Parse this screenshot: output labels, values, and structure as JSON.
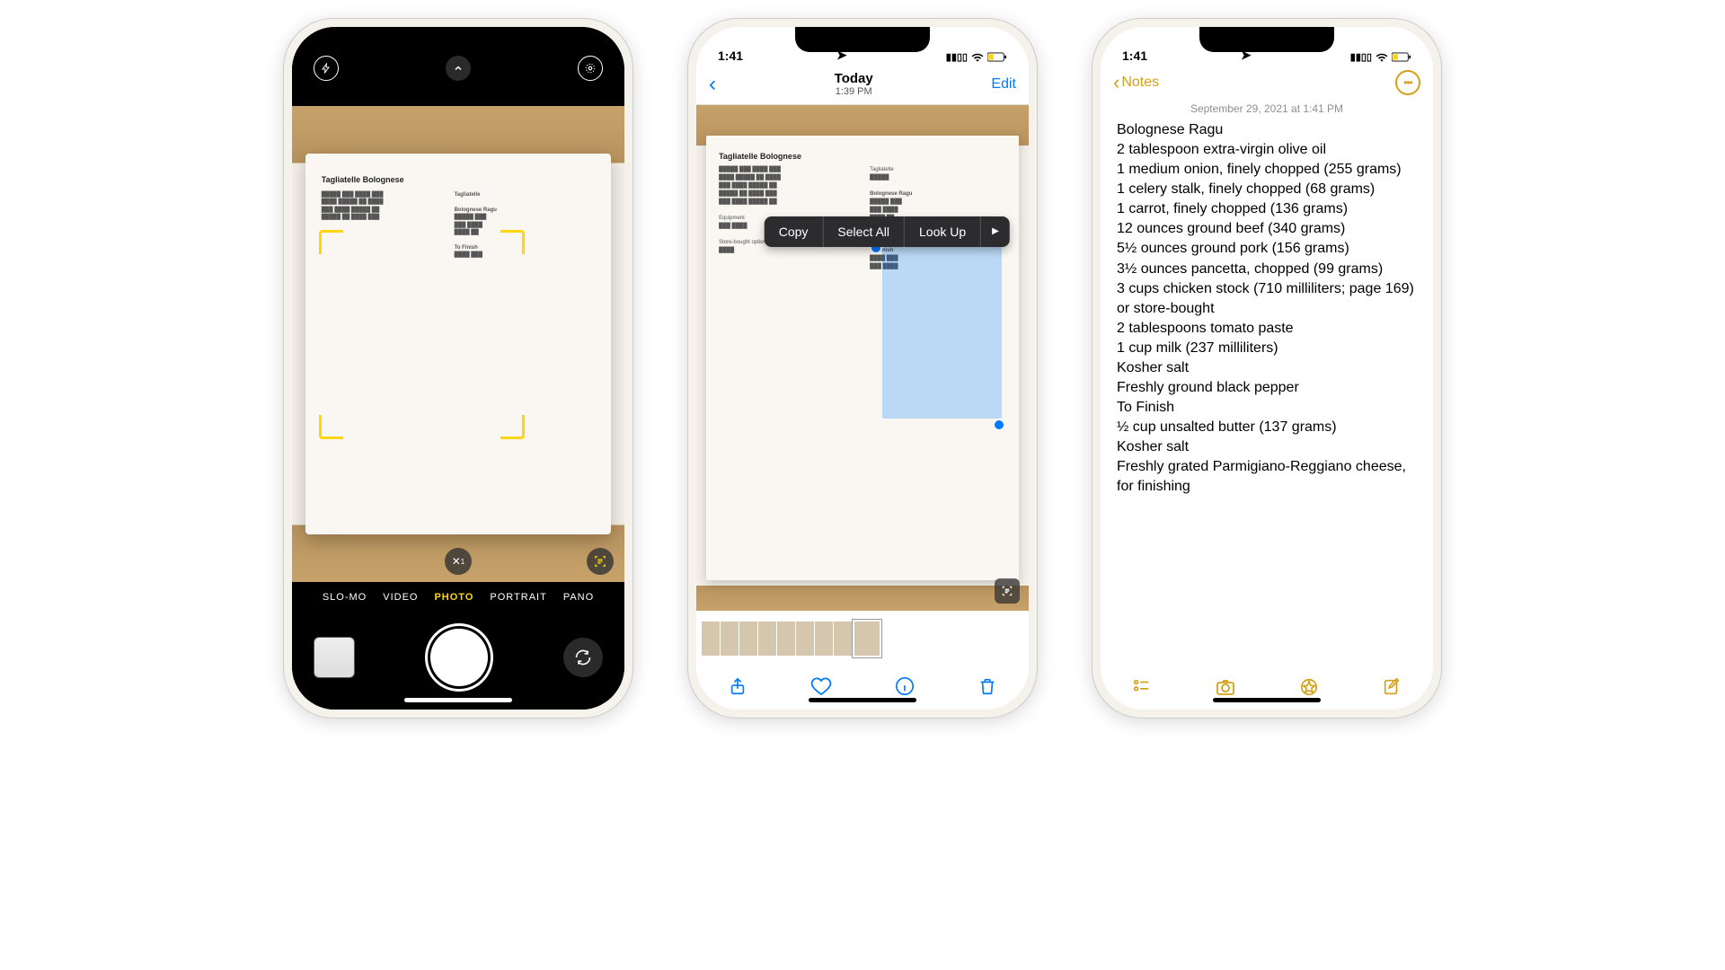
{
  "accent_ios_blue": "#007aff",
  "accent_notes_gold": "#d4a017",
  "accent_camera_yellow": "#ffd60a",
  "camera": {
    "modes": [
      "SLO-MO",
      "VIDEO",
      "PHOTO",
      "PORTRAIT",
      "PANO"
    ],
    "active_mode": "PHOTO",
    "page_title": "Tagliatelle Bolognese"
  },
  "photos": {
    "status_time": "1:41",
    "nav_title": "Today",
    "nav_subtitle": "1:39 PM",
    "edit_label": "Edit",
    "context_menu": [
      "Copy",
      "Select All",
      "Look Up"
    ],
    "page_title": "Tagliatelle Bolognese"
  },
  "notes": {
    "status_time": "1:41",
    "back_label": "Notes",
    "date_line": "September 29, 2021 at 1:41 PM",
    "lines": [
      "Bolognese Ragu",
      "2 tablespoon extra-virgin olive oil",
      "1 medium onion, finely chopped (255 grams)",
      "1 celery stalk, finely chopped (68 grams)",
      "1 carrot, finely chopped (136 grams)",
      "12 ounces ground beef (340 grams)",
      "5½ ounces ground pork (156 grams)",
      "3½ ounces pancetta, chopped (99 grams)",
      "3 cups chicken stock (710 milliliters; page 169) or store-bought",
      "2 tablespoons tomato paste",
      "1 cup milk (237 milliliters)",
      "Kosher salt",
      "Freshly ground black pepper",
      "To Finish",
      "½ cup unsalted butter (137 grams)",
      "Kosher salt",
      "Freshly grated Parmigiano-Reggiano cheese, for finishing"
    ]
  }
}
